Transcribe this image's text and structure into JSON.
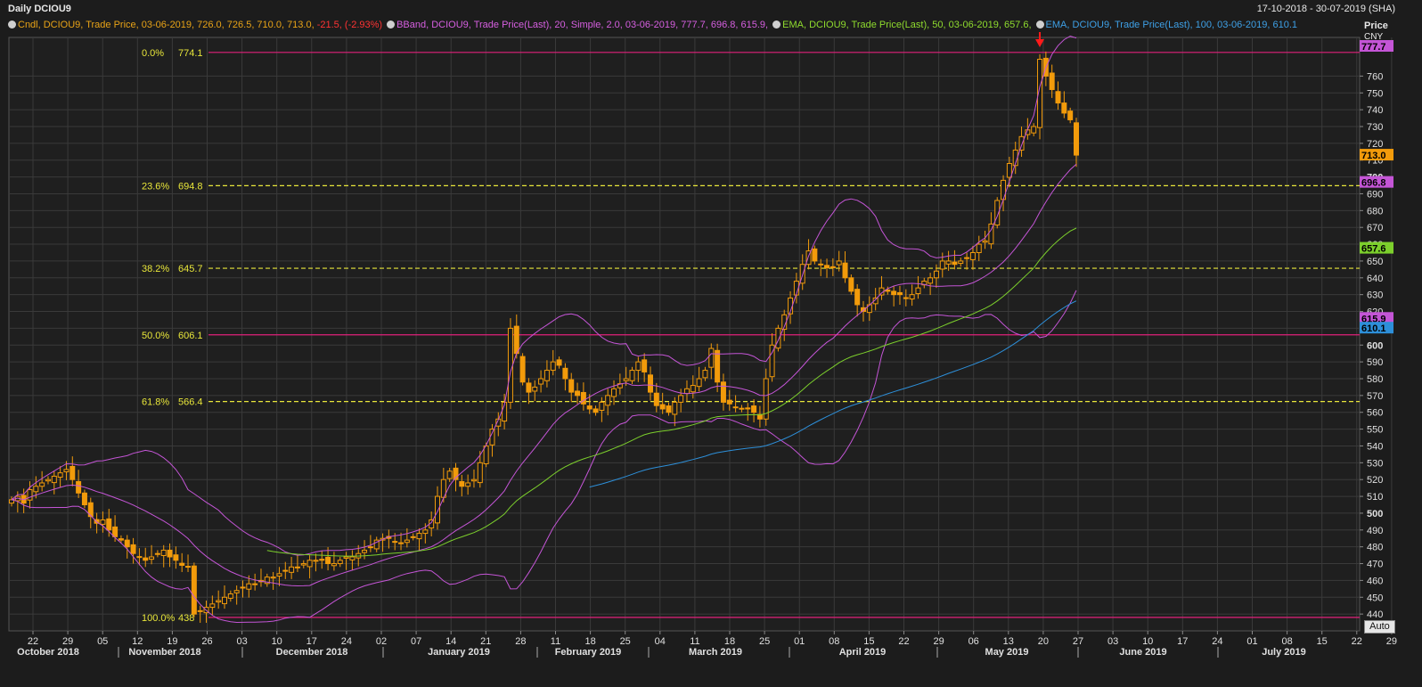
{
  "window": {
    "title": "Daily DCIOU9",
    "date_range": "17-10-2018 - 30-07-2019 (SHA)",
    "price_header": "Price",
    "currency_header": "CNY",
    "auto_button": "Auto"
  },
  "legend": [
    {
      "id": "cndl",
      "parts": [
        {
          "text": "Cndl, DCIOU9, Trade Price, 03-06-2019, 726.0, 726.5, 710.0, 713.0, ",
          "color": "#e8a317"
        },
        {
          "text": "-21.5, (-2.93%)",
          "color": "#ff3333"
        }
      ]
    },
    {
      "id": "bband",
      "parts": [
        {
          "text": "BBand, DCIOU9, Trade Price(Last), 20, Simple, 2.0, 03-06-2019, 777.7, 696.8, 615.9, ",
          "color": "#d65fe0"
        }
      ]
    },
    {
      "id": "ema50",
      "parts": [
        {
          "text": "EMA, DCIOU9, Trade Price(Last), 50, 03-06-2019, 657.6, ",
          "color": "#8fdc2e"
        }
      ]
    },
    {
      "id": "ema100",
      "parts": [
        {
          "text": "EMA, DCIOU9, Trade Price(Last), 100, 03-06-2019, 610.1",
          "color": "#3ea0e6"
        }
      ]
    }
  ],
  "colors": {
    "candle": "#f29b0b",
    "bband": "#c455d6",
    "ema50": "#7ccf2c",
    "ema100": "#2d8fd9",
    "fib_solid": "#e0207a",
    "fib_dashed": "#e8e63a",
    "grid": "#3a3a3a",
    "bg": "#1c1c1c",
    "axis_text": "#e0e0e0",
    "arrow": "#ff1a1a"
  },
  "chart_data": {
    "type": "candlestick",
    "ylim": [
      430,
      783
    ],
    "y_ticks": [
      440,
      450,
      460,
      470,
      480,
      490,
      500,
      510,
      520,
      530,
      540,
      550,
      560,
      570,
      580,
      590,
      600,
      610,
      620,
      630,
      640,
      650,
      660,
      670,
      680,
      690,
      700,
      710,
      720,
      730,
      740,
      750,
      760
    ],
    "x_day_ticks": [
      "22",
      "29",
      "05",
      "12",
      "19",
      "26",
      "03",
      "10",
      "17",
      "24",
      "02",
      "07",
      "14",
      "21",
      "28",
      "11",
      "18",
      "25",
      "04",
      "11",
      "18",
      "25",
      "01",
      "08",
      "15",
      "22",
      "29",
      "06",
      "13",
      "20",
      "27",
      "03",
      "10",
      "17",
      "24",
      "01",
      "08",
      "15",
      "22",
      "29"
    ],
    "x_month_labels": [
      "October 2018",
      "November 2018",
      "December 2018",
      "January 2019",
      "February 2019",
      "March 2019",
      "April 2019",
      "May 2019",
      "June 2019",
      "July 2019"
    ],
    "fibonacci": [
      {
        "pct": "0.0%",
        "value": 774.1,
        "style": "solid"
      },
      {
        "pct": "23.6%",
        "value": 694.8,
        "style": "dashed"
      },
      {
        "pct": "38.2%",
        "value": 645.7,
        "style": "dashed"
      },
      {
        "pct": "50.0%",
        "value": 606.1,
        "style": "solid"
      },
      {
        "pct": "61.8%",
        "value": 566.4,
        "style": "dashed"
      },
      {
        "pct": "100.0%",
        "value": 438,
        "style": "solid"
      }
    ],
    "last_labels": [
      {
        "text": "777.7",
        "value": 777.7,
        "bg": "#c455d6",
        "fg": "#000"
      },
      {
        "text": "713.0",
        "value": 713.0,
        "bg": "#f29b0b",
        "fg": "#000"
      },
      {
        "text": "696.8",
        "value": 696.8,
        "bg": "#c455d6",
        "fg": "#000"
      },
      {
        "text": "657.6",
        "value": 657.6,
        "bg": "#7ccf2c",
        "fg": "#000"
      },
      {
        "text": "615.9",
        "value": 615.9,
        "bg": "#c455d6",
        "fg": "#000"
      },
      {
        "text": "610.1",
        "value": 610.1,
        "bg": "#2d8fd9",
        "fg": "#000"
      }
    ],
    "closes": [
      508,
      510,
      506,
      514,
      516,
      518,
      520,
      522,
      524,
      526,
      520,
      512,
      505,
      498,
      494,
      496,
      490,
      486,
      484,
      480,
      476,
      474,
      472,
      474,
      476,
      478,
      474,
      472,
      469,
      468,
      440,
      442,
      444,
      446,
      448,
      450,
      452,
      454,
      456,
      458,
      458,
      460,
      462,
      462,
      464,
      466,
      468,
      468,
      470,
      472,
      472,
      472,
      470,
      470,
      472,
      474,
      474,
      476,
      478,
      480,
      484,
      485,
      485,
      483,
      482,
      484,
      486,
      488,
      490,
      496,
      510,
      520,
      525,
      520,
      516,
      518,
      520,
      530,
      540,
      550,
      556,
      566,
      610,
      595,
      578,
      572,
      575,
      580,
      585,
      590,
      588,
      580,
      572,
      570,
      565,
      562,
      560,
      566,
      570,
      574,
      577,
      580,
      585,
      590,
      584,
      572,
      564,
      562,
      560,
      566,
      570,
      574,
      576,
      580,
      585,
      598,
      578,
      566,
      565,
      563,
      562,
      562,
      560,
      556,
      580,
      600,
      610,
      618,
      628,
      638,
      648,
      656,
      650,
      648,
      646,
      646,
      650,
      640,
      632,
      624,
      620,
      624,
      628,
      634,
      632,
      630,
      630,
      628,
      630,
      634,
      638,
      640,
      644,
      650,
      650,
      648,
      650,
      652,
      655,
      660,
      662,
      672,
      686,
      698,
      708,
      716,
      724,
      728,
      730,
      770,
      760,
      752,
      744,
      738,
      734,
      713
    ]
  }
}
